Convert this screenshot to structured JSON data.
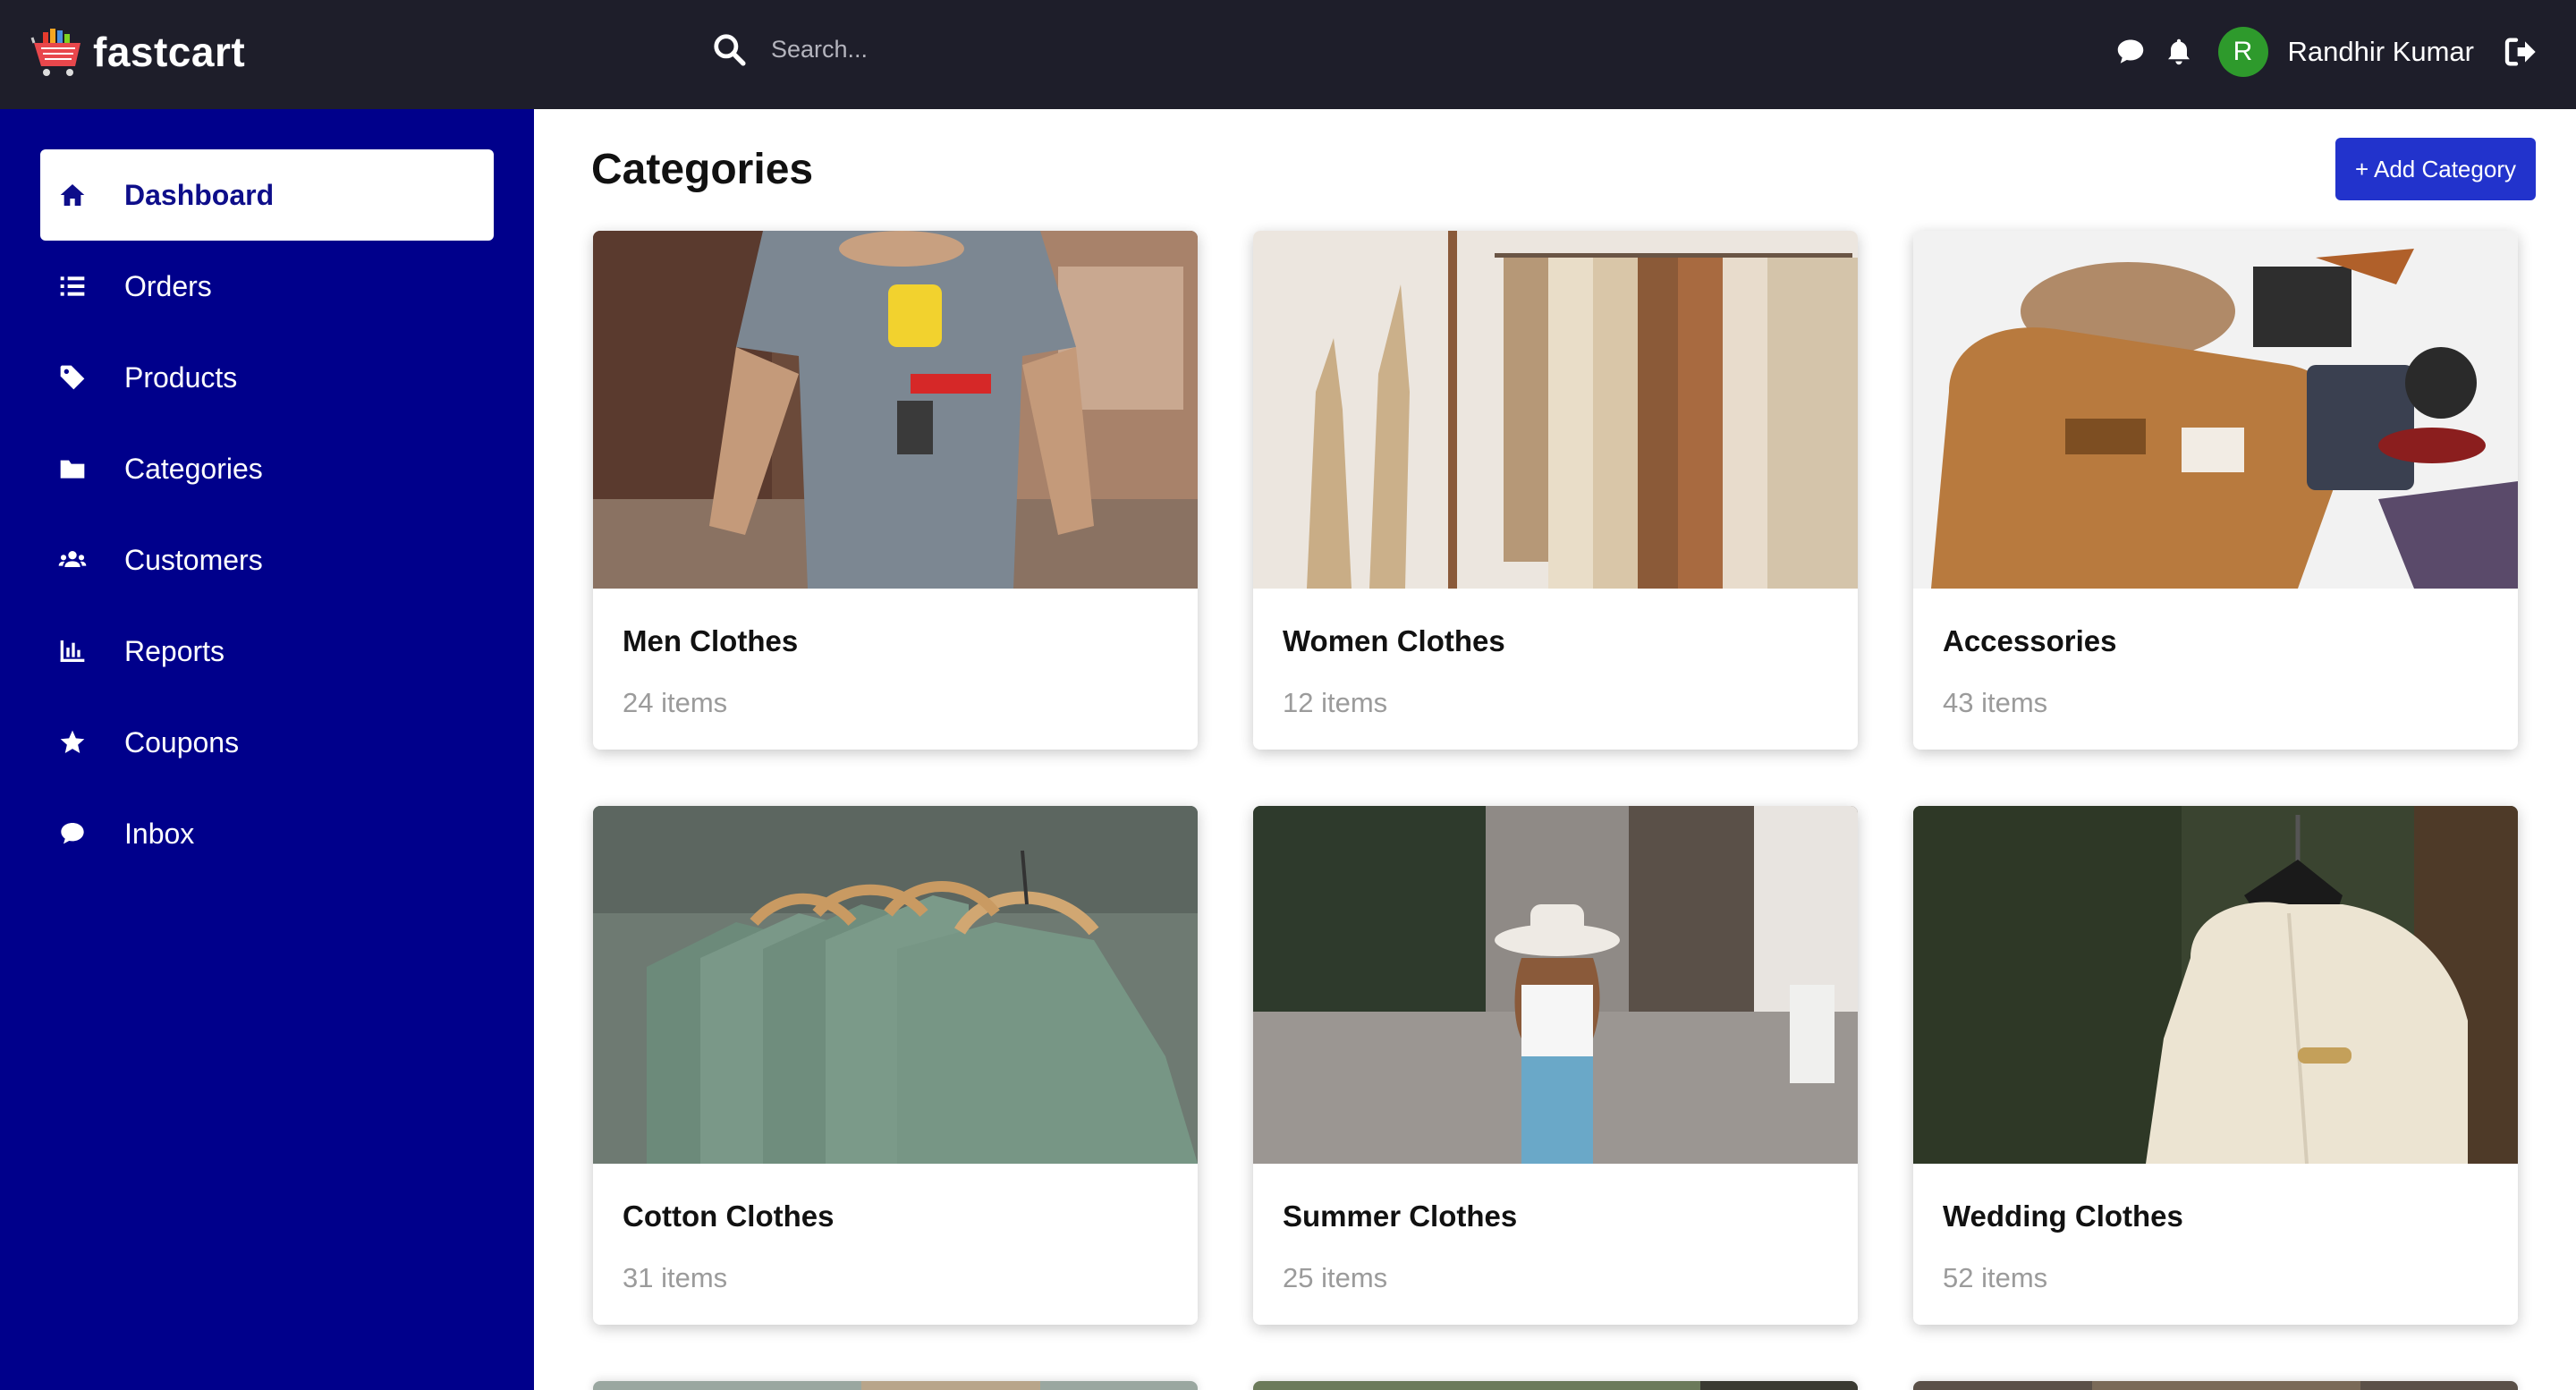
{
  "brand": {
    "name": "fastcart"
  },
  "search": {
    "placeholder": "Search..."
  },
  "user": {
    "initial": "R",
    "name": "Randhir Kumar"
  },
  "sidebar": {
    "items": [
      {
        "label": "Dashboard",
        "icon": "home-icon",
        "active": true
      },
      {
        "label": "Orders",
        "icon": "list-icon"
      },
      {
        "label": "Products",
        "icon": "tag-icon"
      },
      {
        "label": "Categories",
        "icon": "folder-icon"
      },
      {
        "label": "Customers",
        "icon": "users-icon"
      },
      {
        "label": "Reports",
        "icon": "chart-bar-icon"
      },
      {
        "label": "Coupons",
        "icon": "star-icon"
      },
      {
        "label": "Inbox",
        "icon": "chat-bubble-icon"
      }
    ]
  },
  "main": {
    "title": "Categories",
    "add_button": "+ Add Category",
    "categories": [
      {
        "name": "Men Clothes",
        "count": "24 items"
      },
      {
        "name": "Women Clothes",
        "count": "12 items"
      },
      {
        "name": "Accessories",
        "count": "43 items"
      },
      {
        "name": "Cotton Clothes",
        "count": "31 items"
      },
      {
        "name": "Summer Clothes",
        "count": "25 items"
      },
      {
        "name": "Wedding Clothes",
        "count": "52 items"
      }
    ]
  },
  "colors": {
    "topbar": "#1e1e2a",
    "sidebar": "#00008b",
    "accent": "#2233cc",
    "avatar": "#2e9a2c"
  }
}
